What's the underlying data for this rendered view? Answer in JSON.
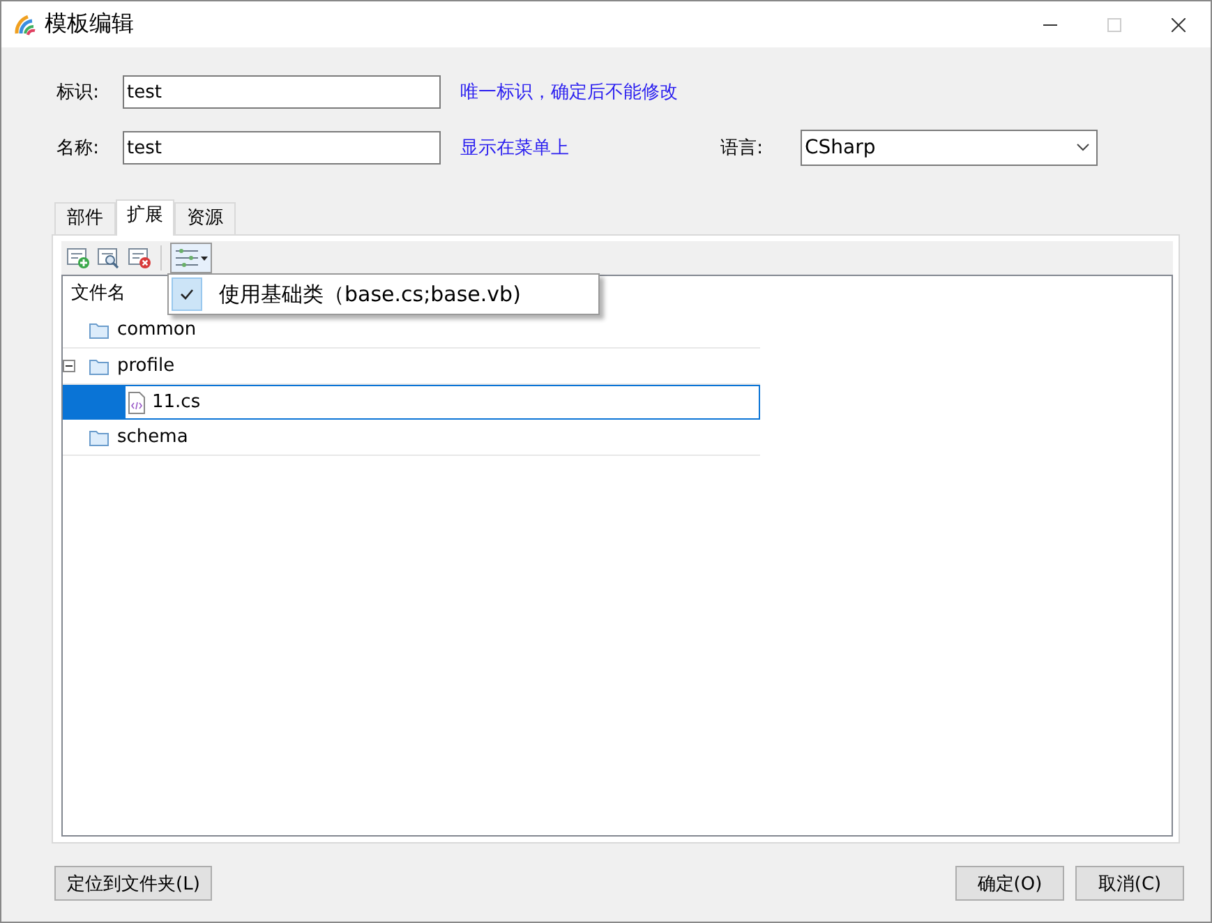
{
  "window": {
    "title": "模板编辑"
  },
  "fields": [
    {
      "label": "标识:",
      "value": "test",
      "hint": "唯一标识，确定后不能修改"
    },
    {
      "label": "名称:",
      "value": "test",
      "hint": "显示在菜单上"
    }
  ],
  "language": {
    "label": "语言:",
    "value": "CSharp"
  },
  "tabs": [
    {
      "label": "部件",
      "selected": false
    },
    {
      "label": "扩展",
      "selected": true
    },
    {
      "label": "资源",
      "selected": false
    }
  ],
  "menu": {
    "items": [
      {
        "label": "使用基础类（base.cs;base.vb)",
        "checked": true
      }
    ]
  },
  "tree": {
    "header": "文件名",
    "items": [
      {
        "kind": "folder",
        "name": "common",
        "selected": false
      },
      {
        "kind": "folder",
        "name": "profile",
        "selected": false,
        "expanded": true,
        "children": [
          {
            "kind": "file",
            "name": "11.cs",
            "selected": true
          }
        ]
      },
      {
        "kind": "folder",
        "name": "schema",
        "selected": false
      }
    ]
  },
  "buttons": {
    "left": [
      "定位到文件夹(L)"
    ],
    "right": [
      "确定(O)",
      "取消(C)"
    ]
  }
}
